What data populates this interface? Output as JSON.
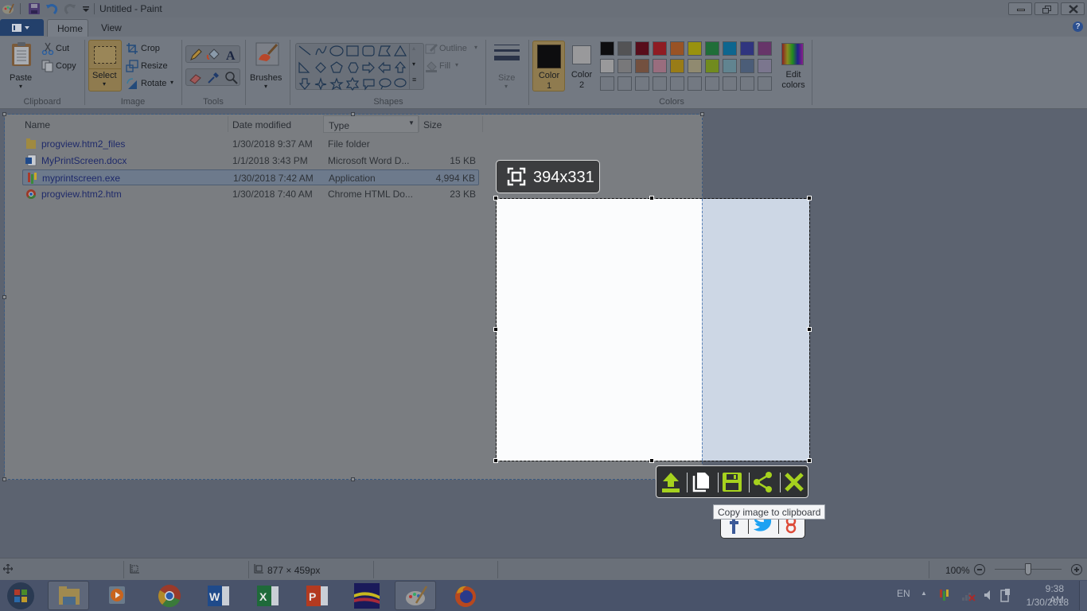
{
  "window": {
    "title": "Untitled - Paint",
    "help_label": "?"
  },
  "ribbon": {
    "tabs": [
      {
        "label": "Home",
        "active": true
      },
      {
        "label": "View",
        "active": false
      }
    ],
    "clipboard": {
      "label": "Clipboard",
      "paste": "Paste",
      "cut": "Cut",
      "copy": "Copy"
    },
    "image": {
      "label": "Image",
      "select": "Select",
      "crop": "Crop",
      "resize": "Resize",
      "rotate": "Rotate"
    },
    "tools": {
      "label": "Tools"
    },
    "brushes": {
      "label": "Brushes"
    },
    "shapes": {
      "label": "Shapes",
      "outline": "Outline",
      "fill": "Fill"
    },
    "size": {
      "label": "Size"
    },
    "colors": {
      "label": "Colors",
      "color1": "Color 1",
      "color2": "Color 2",
      "edit": "Edit colors",
      "color1_value": "#000000",
      "color2_value": "#ffffff",
      "palette_row1": [
        "#000000",
        "#7f7f7f",
        "#880015",
        "#ed1c24",
        "#ff7f27",
        "#fff200",
        "#22b14c",
        "#00a2e8",
        "#3f48cc",
        "#a349a4"
      ],
      "palette_row2": [
        "#ffffff",
        "#c3c3c3",
        "#b97a57",
        "#ffaec9",
        "#ffc90e",
        "#efe4b0",
        "#b5e61d",
        "#99d9ea",
        "#7092be",
        "#c8bfe7"
      ]
    }
  },
  "explorer": {
    "columns": [
      "Name",
      "Date modified",
      "Type",
      "Size"
    ],
    "files": [
      {
        "name": "progview.htm2_files",
        "date": "1/30/2018 9:37 AM",
        "type": "File folder",
        "size": "",
        "icon": "folder-icon",
        "selected": false
      },
      {
        "name": "MyPrintScreen.docx",
        "date": "1/1/2018 3:43 PM",
        "type": "Microsoft Word D...",
        "size": "15 KB",
        "icon": "word-doc-icon",
        "selected": false
      },
      {
        "name": "myprintscreen.exe",
        "date": "1/30/2018 7:42 AM",
        "type": "Application",
        "size": "4,994 KB",
        "icon": "app-icon",
        "selected": true
      },
      {
        "name": "progview.htm2.htm",
        "date": "1/30/2018 7:40 AM",
        "type": "Chrome HTML Do...",
        "size": "23 KB",
        "icon": "chrome-doc-icon",
        "selected": false
      }
    ]
  },
  "capture": {
    "size_label": "394x331",
    "tooltip": "Copy image to clipboard",
    "buttons": [
      "upload",
      "copy",
      "save",
      "share",
      "close"
    ],
    "share_targets": [
      "facebook",
      "twitter",
      "google-plus"
    ]
  },
  "statusbar": {
    "canvas_size": "877 × 459px",
    "zoom": "100%",
    "zoom_level_percent": 100
  },
  "taskbar": {
    "apps": [
      "File Explorer",
      "Windows Media Player",
      "Chrome",
      "Word",
      "Excel",
      "PowerPoint",
      "Image viewer",
      "Paint",
      "Firefox"
    ],
    "language": "EN",
    "time": "9:38 AM",
    "date": "1/30/2018"
  }
}
